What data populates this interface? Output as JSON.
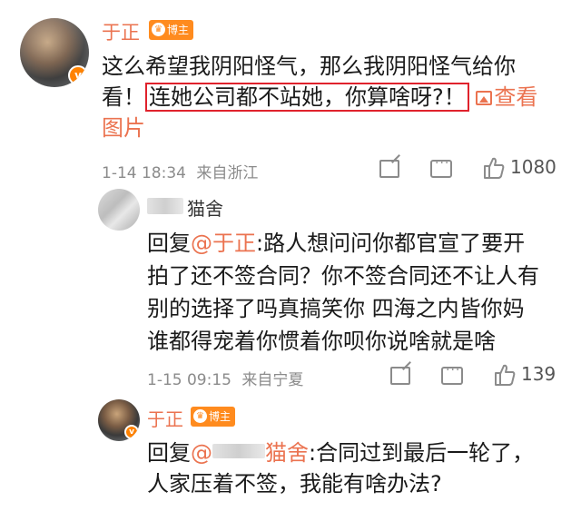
{
  "post": {
    "author": "于正",
    "badge": "博主",
    "text_line1": "这么希望我阴阳怪气，那么我阴阳怪气给你",
    "text_line2_prefix": "看！",
    "text_highlight": "连她公司都不站她，你算啥呀?！",
    "link_label": "查看",
    "text_line3": "图片",
    "timestamp": "1-14 18:34",
    "source": "来自浙江",
    "like_count": "1080"
  },
  "reply1": {
    "author_suffix": "猫舍",
    "reply_prefix": "回复",
    "mention": "@于正",
    "line1_rest": ":路人想问问你都官宣了要开",
    "line2": "拍了还不签合同？你不签合同还不让人有",
    "line3": "别的选择了吗真搞笑你 四海之内皆你妈",
    "line4": "谁都得宠着你惯着你呗你说啥就是啥",
    "timestamp": "1-15 09:15",
    "source": "来自宁夏",
    "like_count": "139"
  },
  "reply2": {
    "author": "于正",
    "badge": "博主",
    "reply_prefix": "回复",
    "mention_suffix": "猫舍",
    "line1_rest": ":合同过到最后一轮了，",
    "line2": "人家压着不签，我能有啥办法?"
  },
  "icons": {
    "verified": "v",
    "crown": "♛"
  },
  "colors": {
    "accent": "#eb7350",
    "highlight_border": "#e0222c",
    "badge_bg": "#ff8b1e",
    "meta_gray": "#8b8b8b"
  }
}
